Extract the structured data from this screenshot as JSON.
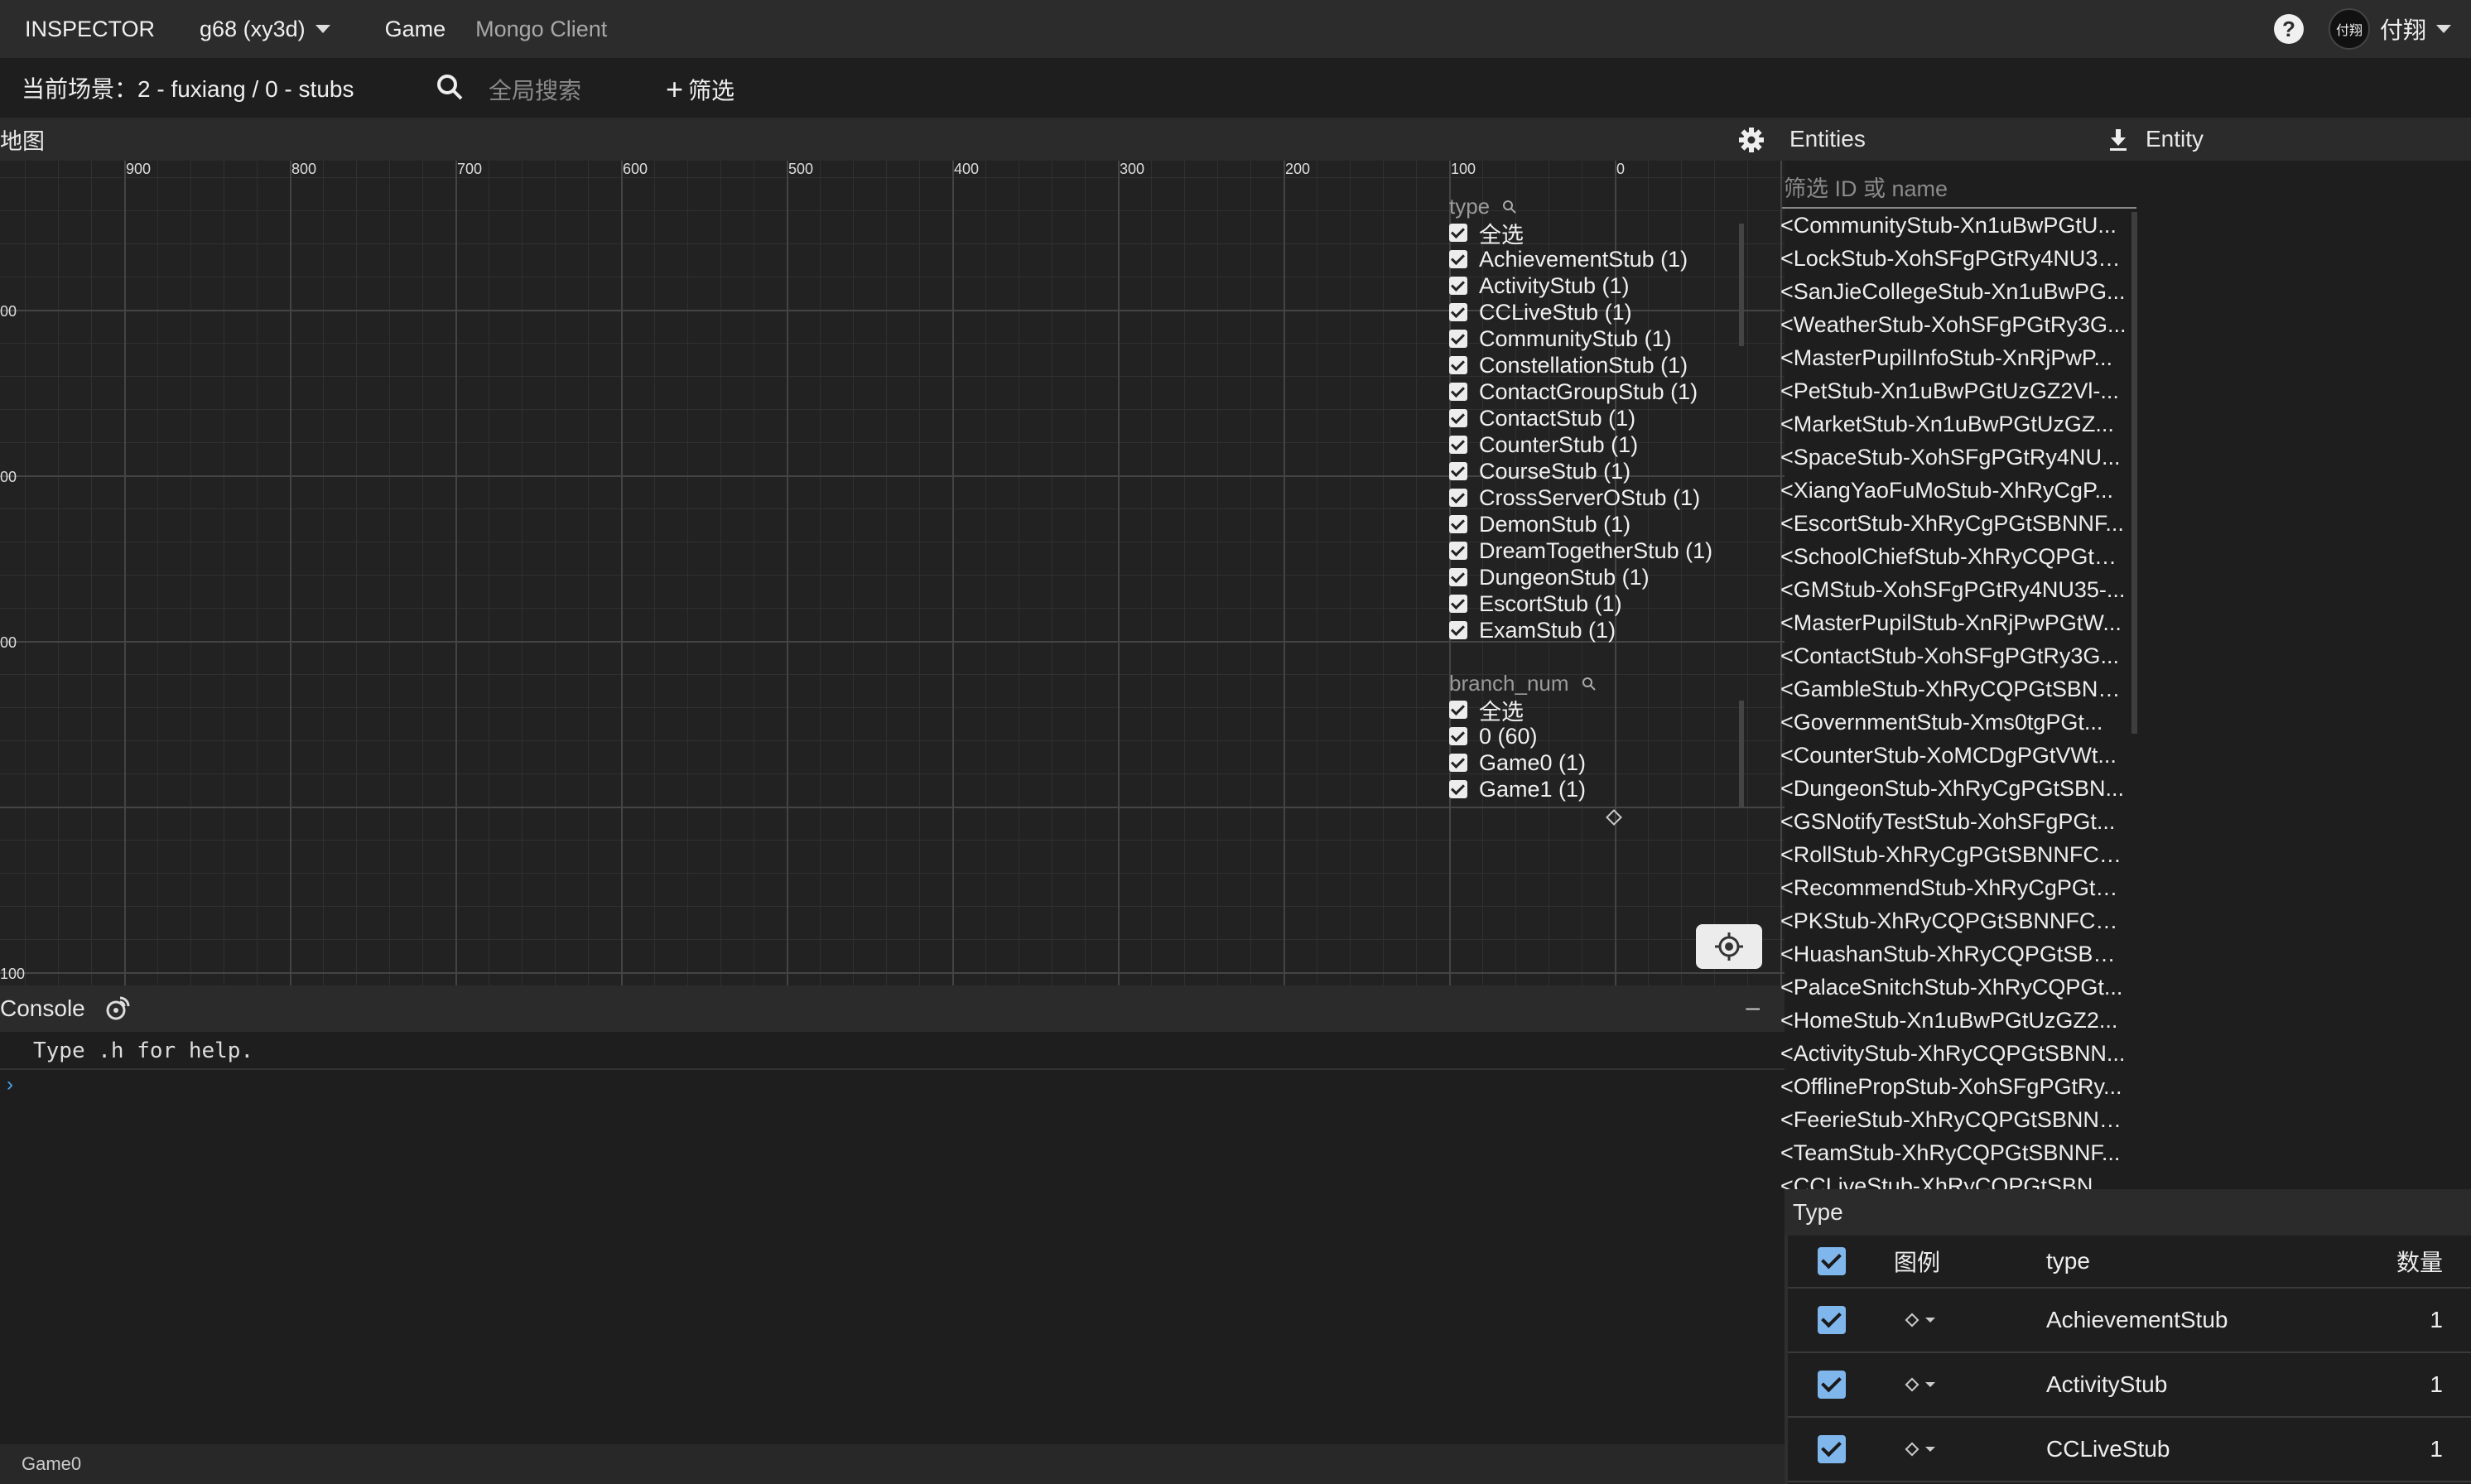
{
  "topbar": {
    "app_title": "INSPECTOR",
    "server": "g68 (xy3d)",
    "nav_game": "Game",
    "nav_mongo": "Mongo Client",
    "avatar_text": "付翔",
    "user_name": "付翔"
  },
  "toolbar": {
    "scene_label": "当前场景：2 - fuxiang / 0 - stubs",
    "search_placeholder": "全局搜索",
    "filter_label": "筛选"
  },
  "map": {
    "title": "地图",
    "x_ticks": [
      "900",
      "800",
      "700",
      "600",
      "500",
      "400",
      "300",
      "200",
      "100",
      "0"
    ],
    "y_ticks": [
      "00",
      "00",
      "00",
      "100"
    ],
    "type_legend": {
      "header": "type",
      "items": [
        "全选",
        "AchievementStub (1)",
        "ActivityStub (1)",
        "CCLiveStub (1)",
        "CommunityStub (1)",
        "ConstellationStub (1)",
        "ContactGroupStub (1)",
        "ContactStub (1)",
        "CounterStub (1)",
        "CourseStub (1)",
        "CrossServerOStub (1)",
        "DemonStub (1)",
        "DreamTogetherStub (1)",
        "DungeonStub (1)",
        "EscortStub (1)",
        "ExamStub (1)"
      ]
    },
    "branch_legend": {
      "header": "branch_num",
      "items": [
        "全选",
        "0 (60)",
        "Game0 (1)",
        "Game1 (1)"
      ]
    }
  },
  "console": {
    "title": "Console",
    "minimize": "–",
    "help_text": "Type .h for help.",
    "prompt": "›"
  },
  "status_bar": {
    "text": "Game0"
  },
  "entities": {
    "title": "Entities",
    "entity_title": "Entity",
    "filter_placeholder": "筛选 ID 或 name",
    "items": [
      "<CommunityStub-Xn1uBwPGtU...",
      "<LockStub-XohSFgPGtRy4NU38...",
      "<SanJieCollegeStub-Xn1uBwPG...",
      "<WeatherStub-XohSFgPGtRy3G...",
      "<MasterPupilInfoStub-XnRjPwP...",
      "<PetStub-Xn1uBwPGtUzGZ2Vl-...",
      "<MarketStub-Xn1uBwPGtUzGZ...",
      "<SpaceStub-XohSFgPGtRy4NU...",
      "<XiangYaoFuMoStub-XhRyCgP...",
      "<EscortStub-XhRyCgPGtSBNNF...",
      "<SchoolChiefStub-XhRyCQPGtS...",
      "<GMStub-XohSFgPGtRy4NU35-...",
      "<MasterPupilStub-XnRjPwPGtW...",
      "<ContactStub-XohSFgPGtRy3G...",
      "<GambleStub-XhRyCQPGtSBNN...",
      "<GovernmentStub-Xms0tgPGt...",
      "<CounterStub-XoMCDgPGtVWt...",
      "<DungeonStub-XhRyCgPGtSBN...",
      "<GSNotifyTestStub-XohSFgPGt...",
      "<RollStub-XhRyCgPGtSBNNFCt-...",
      "<RecommendStub-XhRyCgPGtS...",
      "<PKStub-XhRyCQPGtSBNNFCK-...",
      "<HuashanStub-XhRyCQPGtSBN...",
      "<PalaceSnitchStub-XhRyCQPGt...",
      "<HomeStub-Xn1uBwPGtUzGZ2...",
      "<ActivityStub-XhRyCQPGtSBNN...",
      "<OfflinePropStub-XohSFgPGtRy...",
      "<FeerieStub-XhRyCQPGtSBNNF...",
      "<TeamStub-XhRyCQPGtSBNNF...",
      "<CCLiveStub-XhRyCQPGtSBNN..."
    ]
  },
  "type_table": {
    "title": "Type",
    "col_legend": "图例",
    "col_type": "type",
    "col_count": "数量",
    "rows": [
      {
        "type": "AchievementStub",
        "count": "1"
      },
      {
        "type": "ActivityStub",
        "count": "1"
      },
      {
        "type": "CCLiveStub",
        "count": "1"
      }
    ]
  }
}
